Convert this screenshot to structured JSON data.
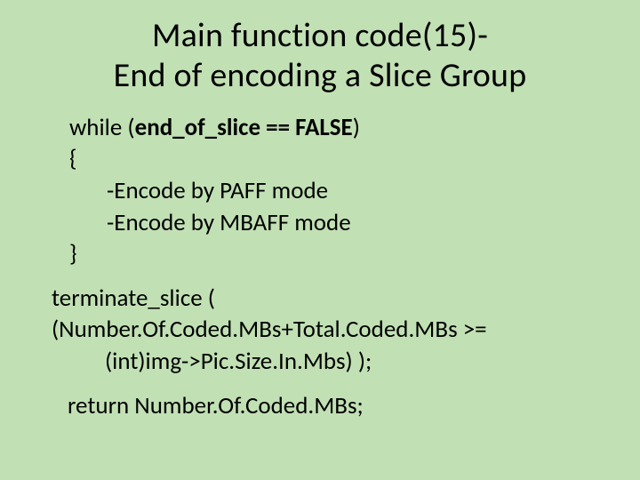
{
  "title_line1": "Main function code(15)-",
  "title_line2": "End of encoding a Slice Group",
  "code": {
    "while_pre": "while (",
    "while_cond": "end_of_slice == FALSE",
    "while_post": ")",
    "open_brace": "{",
    "inner1": "-Encode by PAFF mode",
    "inner2": "-Encode by MBAFF mode",
    "close_brace": "}",
    "term_line1": "terminate_slice ( (Number.Of.Coded.MBs+Total.Coded.MBs >=",
    "term_line2": "(int)img->Pic.Size.In.Mbs) );",
    "return_line": "return Number.Of.Coded.MBs;"
  }
}
